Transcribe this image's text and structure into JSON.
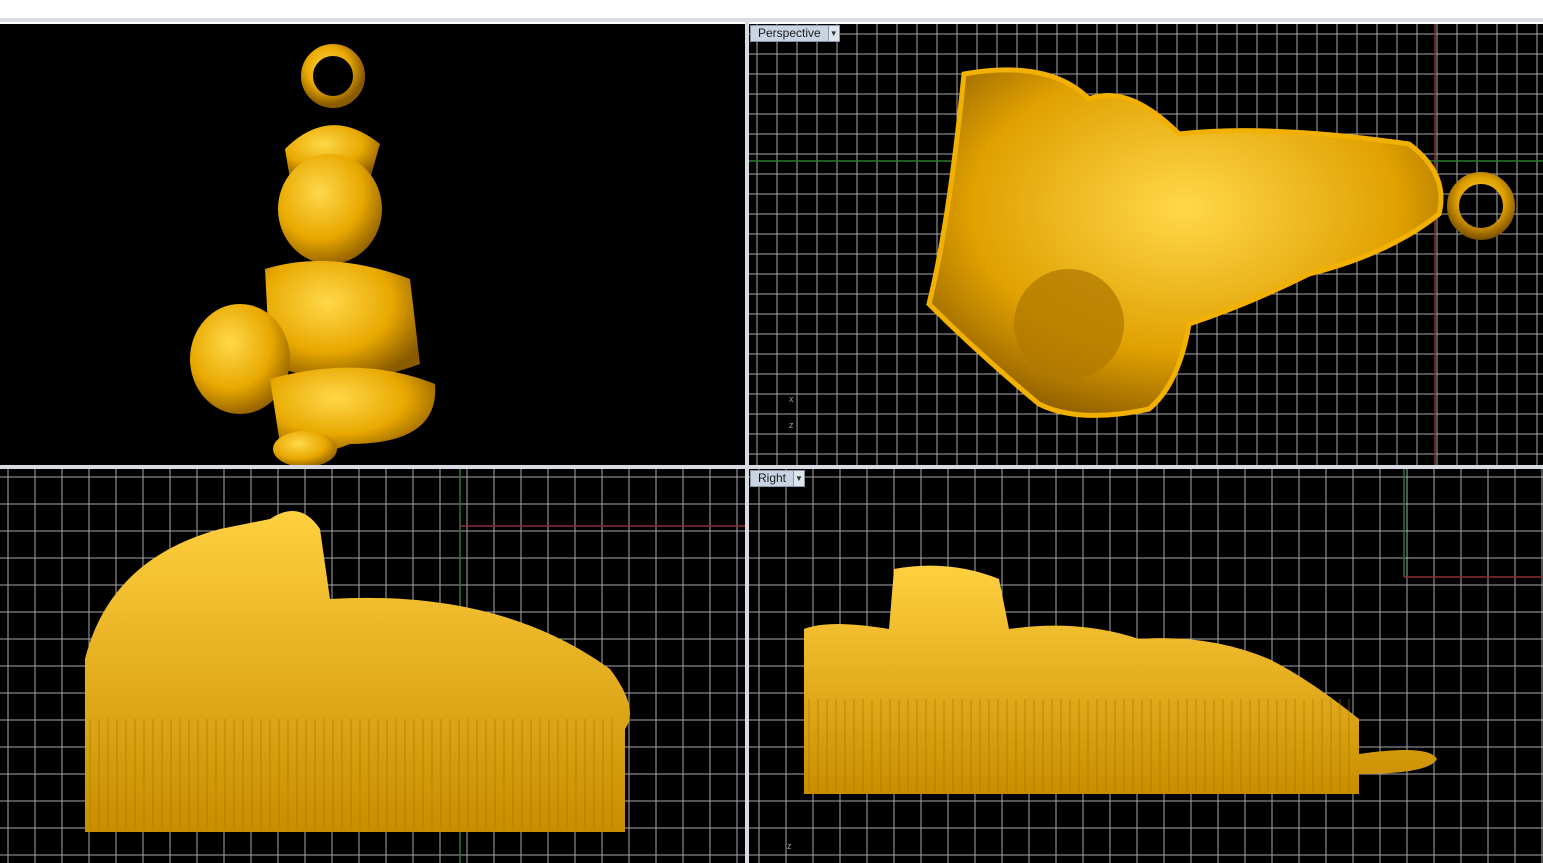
{
  "app": {
    "theme_gold": "#f0b400",
    "background": "#000000"
  },
  "viewports": {
    "top_left": {
      "label": "",
      "model": "pendant-front-render"
    },
    "top_right": {
      "label": "Perspective",
      "menu_icon": "chevron-down-icon",
      "model": "pendant-perspective-render",
      "axis_x": "x",
      "axis_z": "z"
    },
    "bottom_left": {
      "label": "",
      "model": "pendant-side-render"
    },
    "bottom_right": {
      "label": "Right",
      "menu_icon": "chevron-down-icon",
      "model": "pendant-right-render",
      "axis_z": "z"
    }
  }
}
